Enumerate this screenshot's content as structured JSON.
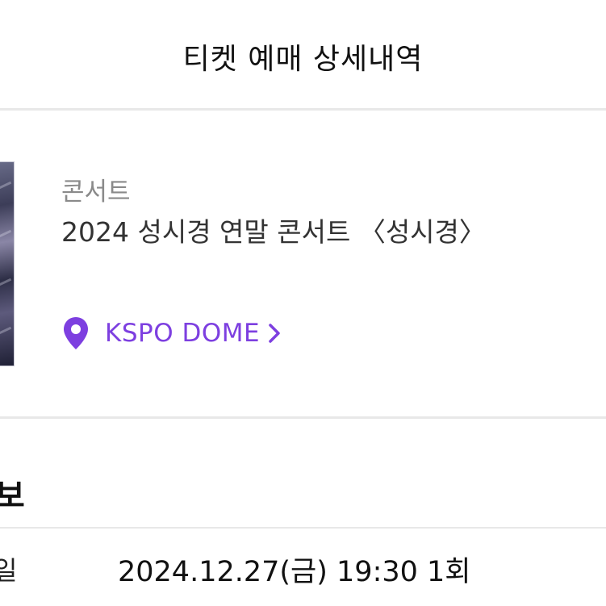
{
  "header": {
    "title": "티켓 예매 상세내역"
  },
  "event": {
    "category": "콘서트",
    "title": "2024 성시경 연말 콘서트 〈성시경〉",
    "venue": {
      "name": "KSPO DOME",
      "icon": "map-pin-icon",
      "chevron": "chevron-right-icon"
    }
  },
  "details": {
    "section_title_partial": "보",
    "date_label_partial": "일",
    "date_value": "2024.12.27(금) 19:30 1회"
  },
  "colors": {
    "accent": "#7d3fe0",
    "divider": "#e8e8e8",
    "muted_text": "#8a8a8a"
  }
}
